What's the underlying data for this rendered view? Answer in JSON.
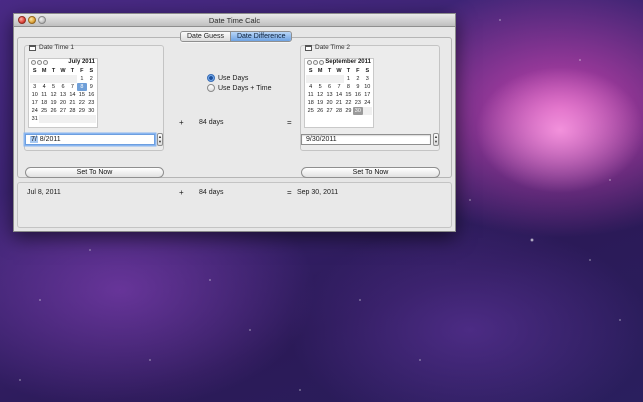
{
  "window": {
    "title": "Date Time Calc"
  },
  "tabs": [
    {
      "label": "Date Guess",
      "active": false
    },
    {
      "label": "Date Difference",
      "active": true
    }
  ],
  "left": {
    "group_label": "Date Time 1",
    "calendar": {
      "month_label": "July 2011",
      "dow": [
        "S",
        "M",
        "T",
        "W",
        "T",
        "F",
        "S"
      ],
      "weeks": [
        [
          "",
          "",
          "",
          "",
          "",
          "1",
          "2"
        ],
        [
          "3",
          "4",
          "5",
          "6",
          "7",
          "8",
          "9"
        ],
        [
          "10",
          "11",
          "12",
          "13",
          "14",
          "15",
          "16"
        ],
        [
          "17",
          "18",
          "19",
          "20",
          "21",
          "22",
          "23"
        ],
        [
          "24",
          "25",
          "26",
          "27",
          "28",
          "29",
          "30"
        ],
        [
          "31",
          "",
          "",
          "",
          "",
          "",
          ""
        ]
      ],
      "selected": "8"
    },
    "date_month": "7/",
    "date_rest": " 8/2011",
    "set_now_label": "Set To Now"
  },
  "right": {
    "group_label": "Date Time 2",
    "calendar": {
      "month_label": "September 2011",
      "dow": [
        "S",
        "M",
        "T",
        "W",
        "T",
        "F",
        "S"
      ],
      "weeks": [
        [
          "",
          "",
          "",
          "",
          "1",
          "2",
          "3"
        ],
        [
          "4",
          "5",
          "6",
          "7",
          "8",
          "9",
          "10"
        ],
        [
          "11",
          "12",
          "13",
          "14",
          "15",
          "16",
          "17"
        ],
        [
          "18",
          "19",
          "20",
          "21",
          "22",
          "23",
          "24"
        ],
        [
          "25",
          "26",
          "27",
          "28",
          "29",
          "30",
          ""
        ]
      ],
      "selected": "30"
    },
    "date_value": "9/30/2011",
    "set_now_label": "Set To Now"
  },
  "options": {
    "use_days": "Use Days",
    "use_days_time": "Use Days + Time",
    "selected": "use_days"
  },
  "middle": {
    "plus": "+",
    "days": "84 days",
    "equals": "="
  },
  "result": {
    "start": "Jul 8, 2011",
    "plus": "+",
    "days": "84 days",
    "equals": "=",
    "end": "Sep 30, 2011"
  },
  "colors": {
    "accent": "#6f9fd8",
    "tab_active": "#8fb8ea"
  }
}
